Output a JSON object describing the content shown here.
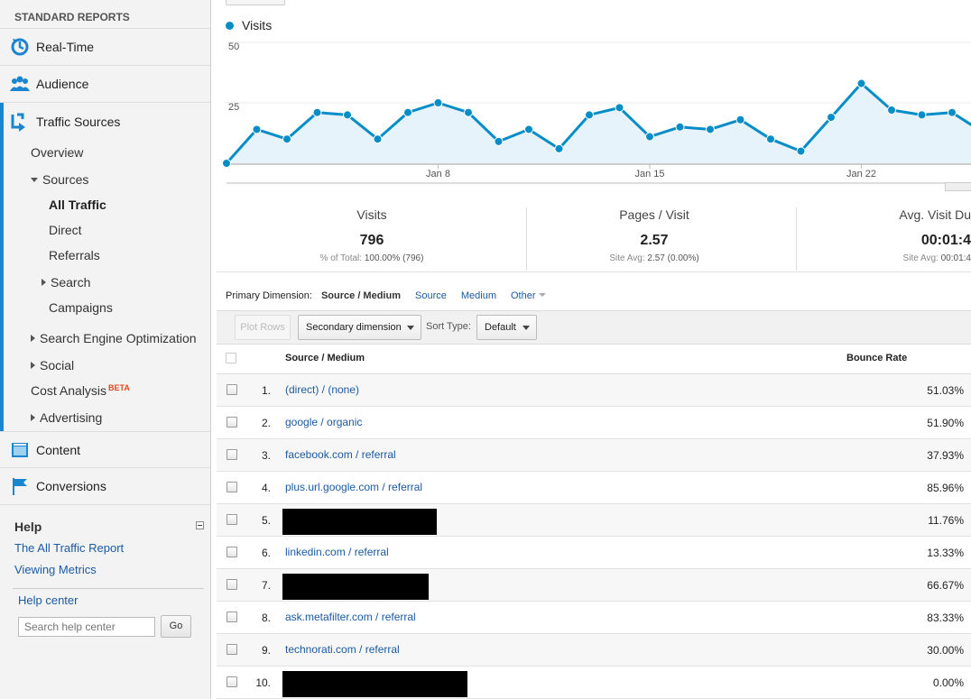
{
  "sidebar": {
    "heading": "STANDARD REPORTS",
    "nav": {
      "realtime": "Real-Time",
      "audience": "Audience",
      "traffic_sources": "Traffic Sources",
      "content": "Content",
      "conversions": "Conversions"
    },
    "traffic_sub": {
      "overview": "Overview",
      "sources": "Sources",
      "all_traffic": "All Traffic",
      "direct": "Direct",
      "referrals": "Referrals",
      "search": "Search",
      "campaigns": "Campaigns",
      "seo": "Search Engine Optimization",
      "social": "Social",
      "cost_analysis": "Cost Analysis",
      "beta": "BETA",
      "advertising": "Advertising"
    },
    "help": {
      "title": "Help",
      "links": [
        "The All Traffic Report",
        "Viewing Metrics"
      ],
      "help_center": "Help center",
      "search_placeholder": "Search help center",
      "go": "Go"
    }
  },
  "chart_data": {
    "type": "area",
    "series": [
      {
        "name": "Visits",
        "values": [
          0,
          14,
          10,
          21,
          20,
          10,
          21,
          25,
          21,
          9,
          14,
          6,
          20,
          23,
          11,
          15,
          14,
          18,
          10,
          5,
          19,
          33,
          22,
          20,
          21,
          13
        ]
      }
    ],
    "x_tick_labels": [
      "Jan 8",
      "Jan 15",
      "Jan 22"
    ],
    "y_tick_labels": [
      "50",
      "25"
    ],
    "ylim": [
      0,
      50
    ],
    "color": "#058dc7"
  },
  "metrics": [
    {
      "label": "Visits",
      "value": "796",
      "sub_label": "% of Total:",
      "sub_value": "100.00% (796)"
    },
    {
      "label": "Pages / Visit",
      "value": "2.57",
      "sub_label": "Site Avg:",
      "sub_value": "2.57 (0.00%)"
    },
    {
      "label": "Avg. Visit Du",
      "value": "00:01:4",
      "sub_label": "Site Avg:",
      "sub_value": "00:01:4"
    }
  ],
  "dimension": {
    "label": "Primary Dimension:",
    "current": "Source / Medium",
    "options": [
      "Source",
      "Medium",
      "Other"
    ]
  },
  "toolbar": {
    "plot_rows": "Plot Rows",
    "secondary": "Secondary dimension",
    "sort_label": "Sort Type:",
    "sort_value": "Default"
  },
  "table": {
    "headers": {
      "source": "Source / Medium",
      "bounce": "Bounce Rate"
    },
    "rows": [
      {
        "num": "1.",
        "source": "(direct) / (none)",
        "bounce": "51.03%"
      },
      {
        "num": "2.",
        "source": "google / organic",
        "bounce": "51.90%"
      },
      {
        "num": "3.",
        "source": "facebook.com / referral",
        "bounce": "37.93%"
      },
      {
        "num": "4.",
        "source": "plus.url.google.com / referral",
        "bounce": "85.96%"
      },
      {
        "num": "5.",
        "source": "",
        "bounce": "11.76%",
        "redacted": 171
      },
      {
        "num": "6.",
        "source": "linkedin.com / referral",
        "bounce": "13.33%"
      },
      {
        "num": "7.",
        "source": "",
        "bounce": "66.67%",
        "redacted": 162
      },
      {
        "num": "8.",
        "source": "ask.metafilter.com / referral",
        "bounce": "83.33%"
      },
      {
        "num": "9.",
        "source": "technorati.com / referral",
        "bounce": "30.00%"
      },
      {
        "num": "10.",
        "source": "",
        "bounce": "0.00%",
        "redacted": 205
      }
    ]
  }
}
